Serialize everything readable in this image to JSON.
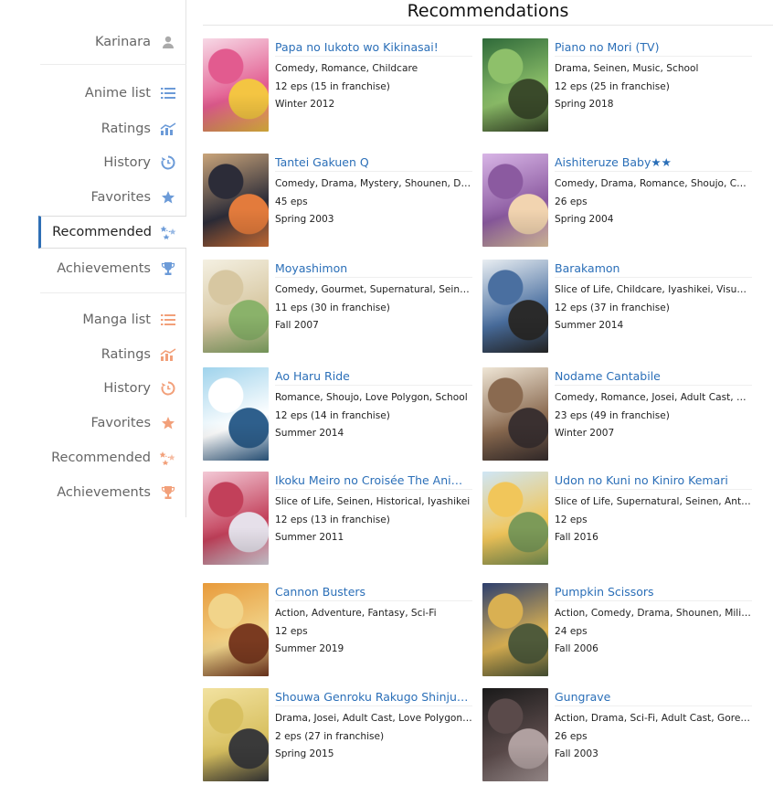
{
  "sidebar": {
    "user": "Karinara",
    "anime": [
      "Anime list",
      "Ratings",
      "History",
      "Favorites",
      "Recommended",
      "Achievements"
    ],
    "manga": [
      "Manga list",
      "Ratings",
      "History",
      "Favorites",
      "Recommended",
      "Achievements"
    ],
    "active_index": 4,
    "icon_color_anime": "#6c9bd8",
    "icon_color_manga": "#f2a07a"
  },
  "page": {
    "title": "Recommendations"
  },
  "cards": [
    {
      "title": "Papa no Iukoto wo Kikinasai!",
      "genres": "Comedy, Romance, Childcare",
      "eps": "12 eps (15 in franchise)",
      "season": "Winter 2012",
      "colors": [
        "#f7d9e6",
        "#e25b8f",
        "#f4c542"
      ]
    },
    {
      "title": "Piano no Mori (TV)",
      "genres": "Drama, Seinen, Music, School",
      "eps": "12 eps (25 in franchise)",
      "season": "Spring 2018",
      "colors": [
        "#2f6a3a",
        "#8ec06a",
        "#3a4a2a"
      ]
    },
    {
      "title": "Tantei Gakuen Q",
      "genres": "Comedy, Drama, Mystery, Shounen, De...",
      "eps": "45 eps",
      "season": "Spring 2003",
      "colors": [
        "#c9a47a",
        "#2c2c38",
        "#e37b3c"
      ]
    },
    {
      "title": "Aishiteruze Baby★★",
      "genres": "Comedy, Drama, Romance, Shoujo, Chil...",
      "eps": "26 eps",
      "season": "Spring 2004",
      "colors": [
        "#d8b5e6",
        "#8b5aa0",
        "#f2d4b0"
      ]
    },
    {
      "title": "Moyashimon",
      "genres": "Comedy, Gourmet, Supernatural, Seine...",
      "eps": "11 eps (30 in franchise)",
      "season": "Fall 2007",
      "colors": [
        "#f4f0e2",
        "#d7c7a1",
        "#8ab26a"
      ]
    },
    {
      "title": "Barakamon",
      "genres": "Slice of Life, Childcare, Iyashikei, Visual ...",
      "eps": "12 eps (37 in franchise)",
      "season": "Summer 2014",
      "colors": [
        "#e9eef2",
        "#4a6fa0",
        "#2a2a2a"
      ]
    },
    {
      "title": "Ao Haru Ride",
      "genres": "Romance, Shoujo, Love Polygon, School",
      "eps": "12 eps (14 in franchise)",
      "season": "Summer 2014",
      "colors": [
        "#9fd3ec",
        "#ffffff",
        "#2e5f8c"
      ]
    },
    {
      "title": "Nodame Cantabile",
      "genres": "Comedy, Romance, Josei, Adult Cast, M...",
      "eps": "23 eps (49 in franchise)",
      "season": "Winter 2007",
      "colors": [
        "#efe6d6",
        "#8a6a50",
        "#3a3030"
      ]
    },
    {
      "title": "Ikoku Meiro no Croisée The Anim...",
      "genres": "Slice of Life, Seinen, Historical, Iyashikei",
      "eps": "12 eps (13 in franchise)",
      "season": "Summer 2011",
      "colors": [
        "#f3c9d6",
        "#c2405a",
        "#e6e0ea"
      ]
    },
    {
      "title": "Udon no Kuni no Kiniro Kemari",
      "genres": "Slice of Life, Supernatural, Seinen, Anth...",
      "eps": "12 eps",
      "season": "Fall 2016",
      "colors": [
        "#cfe6f5",
        "#f1c65a",
        "#7c9a58"
      ]
    },
    {
      "title": "Cannon Busters",
      "genres": "Action, Adventure, Fantasy, Sci-Fi",
      "eps": "12 eps",
      "season": "Summer 2019",
      "colors": [
        "#e89a3a",
        "#f1d48a",
        "#7a3a20"
      ]
    },
    {
      "title": "Pumpkin Scissors",
      "genres": "Action, Comedy, Drama, Shounen, Milit...",
      "eps": "24 eps",
      "season": "Fall 2006",
      "colors": [
        "#2d3f6e",
        "#d9b052",
        "#4f5a3a"
      ]
    },
    {
      "title": "Shouwa Genroku Rakugo Shinjuu...",
      "genres": "Drama, Josei, Adult Cast, Love Polygon, ...",
      "eps": "2 eps (27 in franchise)",
      "season": "Spring 2015",
      "colors": [
        "#f2e2a0",
        "#d8c060",
        "#3a3a3a"
      ]
    },
    {
      "title": "Gungrave",
      "genres": "Action, Drama, Sci-Fi, Adult Cast, Gore, ...",
      "eps": "26 eps",
      "season": "Fall 2003",
      "colors": [
        "#1a1a1a",
        "#5a4a4a",
        "#b0a0a0"
      ]
    }
  ]
}
